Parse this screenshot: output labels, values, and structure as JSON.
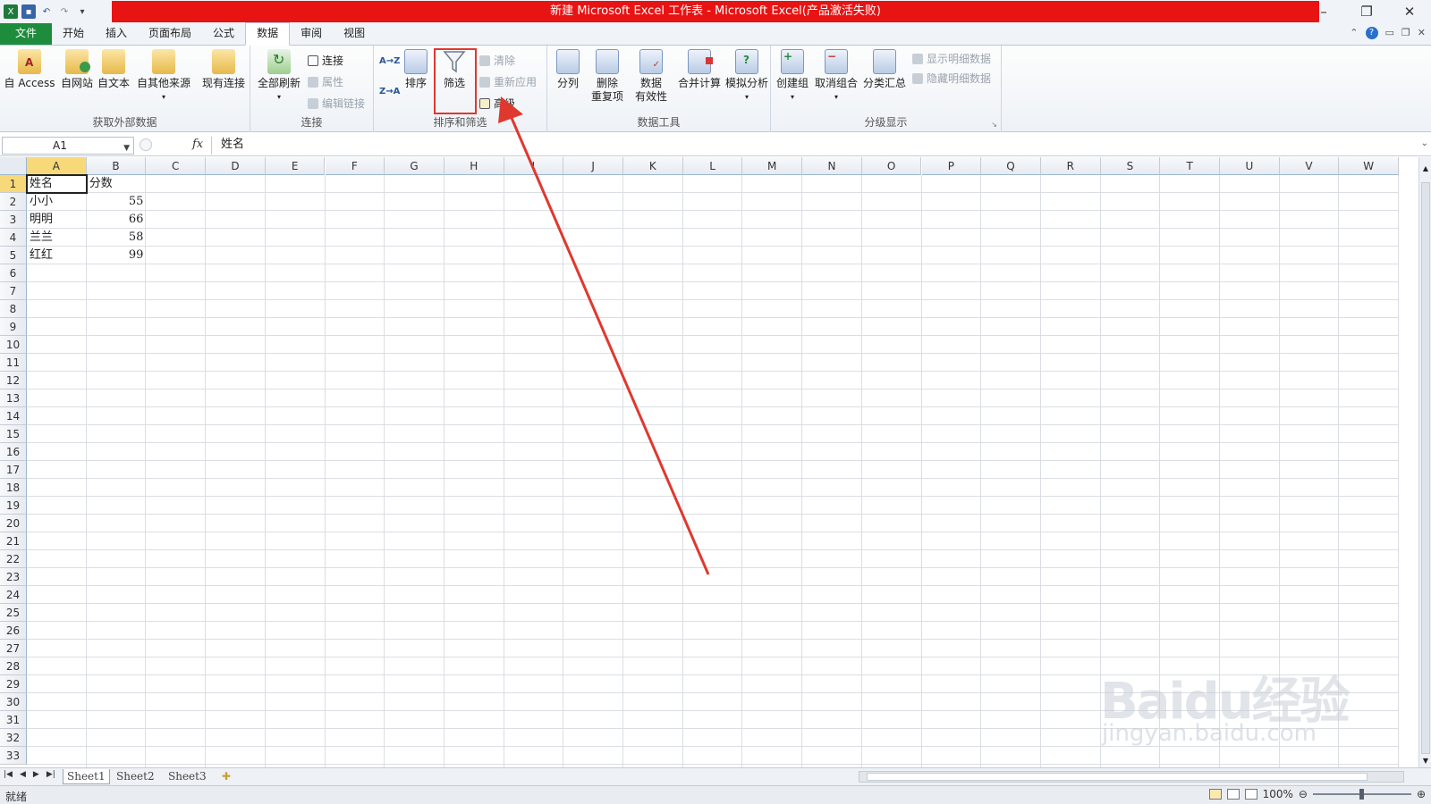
{
  "window": {
    "title": "新建 Microsoft Excel 工作表 - Microsoft Excel(产品激活失败)",
    "title_bar_color": "#e81313"
  },
  "qat": {
    "icons": [
      "excel-icon",
      "save-icon",
      "undo-icon",
      "redo-icon",
      "customize-icon"
    ]
  },
  "tabs": [
    {
      "label": "文件",
      "active": false
    },
    {
      "label": "开始",
      "active": false
    },
    {
      "label": "插入",
      "active": false
    },
    {
      "label": "页面布局",
      "active": false
    },
    {
      "label": "公式",
      "active": false
    },
    {
      "label": "数据",
      "active": true
    },
    {
      "label": "审阅",
      "active": false
    },
    {
      "label": "视图",
      "active": false
    }
  ],
  "ribbon": {
    "external": {
      "label": "获取外部数据",
      "access": "自 Access",
      "web": "自网站",
      "text": "自文本",
      "other": "自其他来源",
      "existing": "现有连接"
    },
    "connections": {
      "label": "连接",
      "refresh": "全部刷新",
      "conn": "连接",
      "props": "属性",
      "edit": "编辑链接"
    },
    "sortfilter": {
      "label": "排序和筛选",
      "sort_az": "A→Z",
      "sort_za": "Z→A",
      "sort": "排序",
      "filter": "筛选",
      "clear": "清除",
      "reapply": "重新应用",
      "advanced": "高级"
    },
    "datatools": {
      "label": "数据工具",
      "split": "分列",
      "dedupe_a": "删除",
      "dedupe_b": "重复项",
      "valid_a": "数据",
      "valid_b": "有效性",
      "consolidate": "合并计算",
      "whatif": "模拟分析"
    },
    "outline": {
      "label": "分级显示",
      "group": "创建组",
      "ungroup": "取消组合",
      "subtotal": "分类汇总",
      "show": "显示明细数据",
      "hide": "隐藏明细数据"
    }
  },
  "formula_bar": {
    "name_box": "A1",
    "fx": "fx",
    "content": "姓名"
  },
  "columns": [
    "A",
    "B",
    "C",
    "D",
    "E",
    "F",
    "G",
    "H",
    "I",
    "J",
    "K",
    "L",
    "M",
    "N",
    "O",
    "P",
    "Q",
    "R",
    "S",
    "T",
    "U",
    "V",
    "W"
  ],
  "rows": [
    "1",
    "2",
    "3",
    "4",
    "5",
    "6",
    "7",
    "8",
    "9",
    "10",
    "11",
    "12",
    "13",
    "14",
    "15",
    "16",
    "17",
    "18",
    "19",
    "20",
    "21",
    "22",
    "23",
    "24",
    "25",
    "26",
    "27",
    "28",
    "29",
    "30",
    "31",
    "32",
    "33"
  ],
  "cells": {
    "A1": "姓名",
    "B1": "分数",
    "A2": "小小",
    "B2": "55",
    "A3": "明明",
    "B3": "66",
    "A4": "兰兰",
    "B4": "58",
    "A5": "红红",
    "B5": "99"
  },
  "sheets": [
    "Sheet1",
    "Sheet2",
    "Sheet3"
  ],
  "status": {
    "left": "就绪",
    "zoom": "100%"
  },
  "watermark": {
    "line1": "Baidu经验",
    "line2": "jingyan.baidu.com"
  },
  "annotation_color": "#e0382f"
}
